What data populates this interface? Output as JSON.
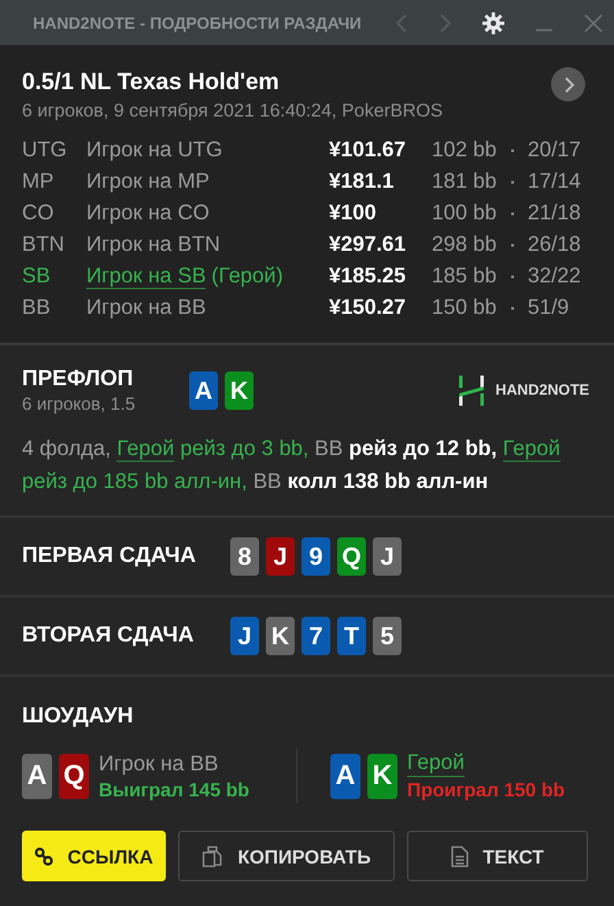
{
  "window": {
    "title": "HAND2NOTE - ПОДРОБНОСТИ РАЗДАЧИ"
  },
  "hand": {
    "title": "0.5/1 NL Texas Hold'em",
    "subtitle": "6 игроков, 9 сентября 2021 16:40:24, PokerBROS"
  },
  "players": [
    {
      "position": "UTG",
      "name": "Игрок на UTG",
      "stack": "¥101.67",
      "bb": "102 bb",
      "stats": "20/17",
      "hero": false
    },
    {
      "position": "MP",
      "name": "Игрок на MP",
      "stack": "¥181.1",
      "bb": "181 bb",
      "stats": "17/14",
      "hero": false
    },
    {
      "position": "CO",
      "name": "Игрок на CO",
      "stack": "¥100",
      "bb": "100 bb",
      "stats": "21/18",
      "hero": false
    },
    {
      "position": "BTN",
      "name": "Игрок на BTN",
      "stack": "¥297.61",
      "bb": "298 bb",
      "stats": "26/18",
      "hero": false
    },
    {
      "position": "SB",
      "name": "Игрок на SB",
      "hero_tag": "(Герой)",
      "stack": "¥185.25",
      "bb": "185 bb",
      "stats": "32/22",
      "hero": true
    },
    {
      "position": "BB",
      "name": "Игрок на BB",
      "stack": "¥150.27",
      "bb": "150 bb",
      "stats": "51/9",
      "hero": false
    }
  ],
  "preflop": {
    "title": "ПРЕФЛОП",
    "subtitle": "6 игроков, 1.5",
    "cards": [
      {
        "rank": "A",
        "color": "#0a5bb0"
      },
      {
        "rank": "K",
        "color": "#0b8f1e"
      }
    ],
    "logo": "HAND2NOTE",
    "actions": [
      {
        "text": "4 фолда, ",
        "kind": "muted"
      },
      {
        "text": "Герой",
        "kind": "hero-link"
      },
      {
        "text": " рейз до 3 bb, ",
        "kind": "hero"
      },
      {
        "text": "BB ",
        "kind": "muted"
      },
      {
        "text": "рейз до 12 bb, ",
        "kind": "action"
      },
      {
        "text": "Герой",
        "kind": "hero-link"
      },
      {
        "text": " рейз до 185 bb алл-ин, ",
        "kind": "hero"
      },
      {
        "text": "BB ",
        "kind": "muted"
      },
      {
        "text": "колл 138 bb алл-ин",
        "kind": "action"
      }
    ]
  },
  "boards": [
    {
      "title": "ПЕРВАЯ СДАЧА",
      "cards": [
        {
          "rank": "8",
          "color": "#666666"
        },
        {
          "rank": "J",
          "color": "#a00a0a"
        },
        {
          "rank": "9",
          "color": "#0a5bb0"
        },
        {
          "rank": "Q",
          "color": "#0b8f1e"
        },
        {
          "rank": "J",
          "color": "#666666"
        }
      ]
    },
    {
      "title": "ВТОРАЯ СДАЧА",
      "cards": [
        {
          "rank": "J",
          "color": "#0a5bb0"
        },
        {
          "rank": "K",
          "color": "#666666"
        },
        {
          "rank": "7",
          "color": "#0a5bb0"
        },
        {
          "rank": "T",
          "color": "#0a5bb0"
        },
        {
          "rank": "5",
          "color": "#666666"
        }
      ]
    }
  ],
  "showdown": {
    "title": "ШОУДАУН",
    "hands": [
      {
        "name": "Игрок на BB",
        "hero": false,
        "result": "Выиграл 145 bb",
        "won": true,
        "cards": [
          {
            "rank": "A",
            "color": "#666666"
          },
          {
            "rank": "Q",
            "color": "#a00a0a"
          }
        ]
      },
      {
        "name": "Герой",
        "hero": true,
        "result": "Проиграл 150 bb",
        "won": false,
        "cards": [
          {
            "rank": "A",
            "color": "#0a5bb0"
          },
          {
            "rank": "K",
            "color": "#0b8f1e"
          }
        ]
      }
    ]
  },
  "buttons": [
    {
      "label": "ССЫЛКА",
      "kind": "link"
    },
    {
      "label": "КОПИРОВАТЬ",
      "kind": "copy"
    },
    {
      "label": "ТЕКСТ",
      "kind": "text"
    }
  ]
}
